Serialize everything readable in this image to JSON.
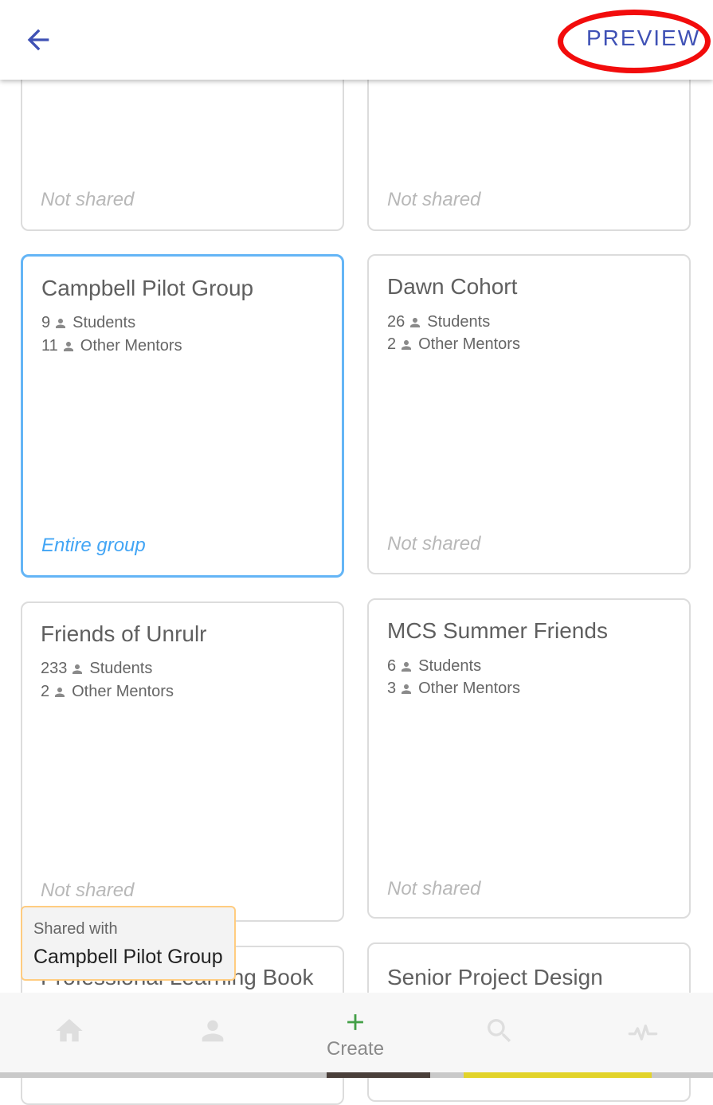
{
  "header": {
    "preview_label": "PREVIEW"
  },
  "groups": [
    {
      "title": "",
      "students": "",
      "mentors": "",
      "share_status": "Not shared"
    },
    {
      "title": "",
      "students": "",
      "mentors": "",
      "share_status": "Not shared"
    },
    {
      "title": "Campbell Pilot Group",
      "students": "9",
      "students_label": "Students",
      "mentors": "11",
      "mentors_label": "Other Mentors",
      "share_status": "Entire group",
      "selected": true
    },
    {
      "title": "Dawn Cohort",
      "students": "26",
      "students_label": "Students",
      "mentors": "2",
      "mentors_label": "Other Mentors",
      "share_status": "Not shared"
    },
    {
      "title": "Friends of Unrulr",
      "students": "233",
      "students_label": "Students",
      "mentors": "2",
      "mentors_label": "Other Mentors",
      "share_status": "Not shared"
    },
    {
      "title": "MCS Summer Friends",
      "students": "6",
      "students_label": "Students",
      "mentors": "3",
      "mentors_label": "Other Mentors",
      "share_status": "Not shared"
    },
    {
      "title": "Professional Learning Book"
    },
    {
      "title": "Senior Project Design Thinking Groups"
    }
  ],
  "tooltip": {
    "label": "Shared with",
    "value": "Campbell Pilot Group"
  },
  "bottom_nav": {
    "items": [
      {
        "icon": "home-icon"
      },
      {
        "icon": "person-icon"
      },
      {
        "icon": "plus-icon",
        "label": "Create",
        "active": true
      },
      {
        "icon": "search-icon"
      },
      {
        "icon": "activity-icon"
      }
    ]
  },
  "colors": {
    "accent": "#3f51b5",
    "selected_border": "#64b5f6",
    "shared_text": "#42a5f5",
    "create_green": "#43a047",
    "highlight_ring": "#f20c0c",
    "tooltip_border": "#ffcc80"
  }
}
